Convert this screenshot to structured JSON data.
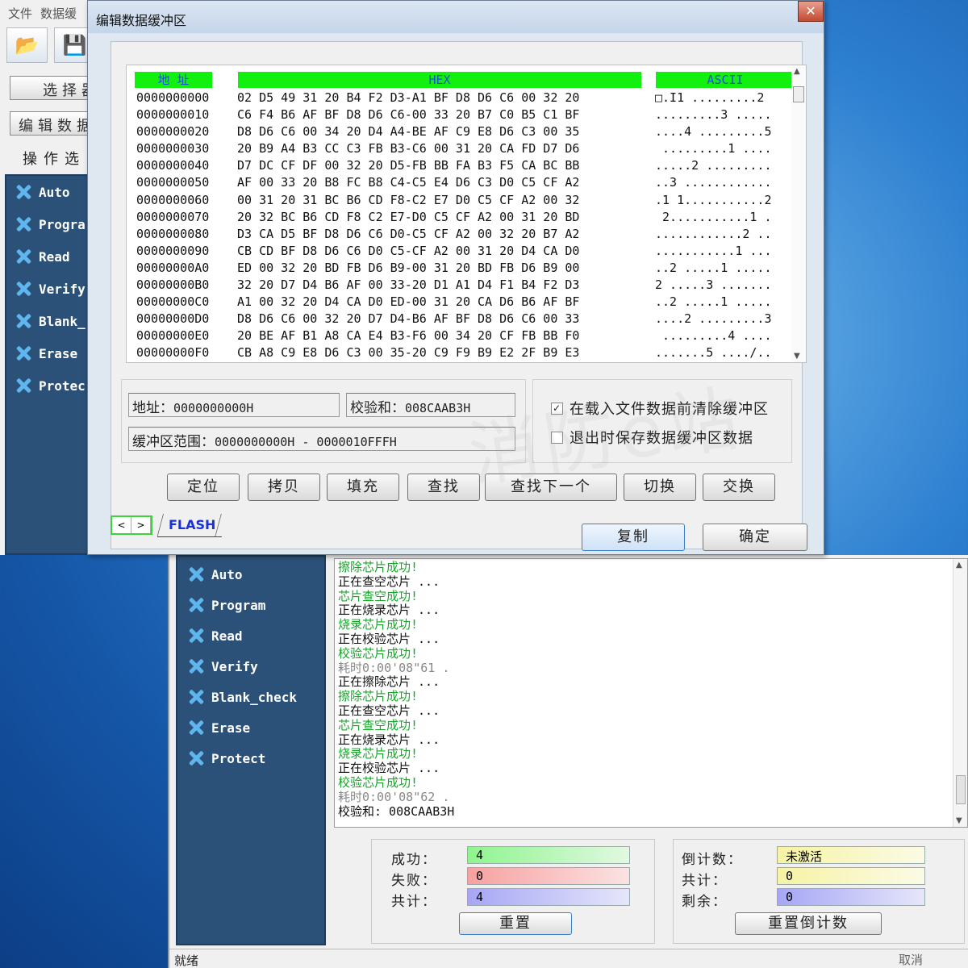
{
  "back_window": {
    "menu": [
      "文件",
      "数据缓"
    ],
    "select_button": "选择器",
    "edit_button": "编辑数据",
    "ops_label": "操作选",
    "nav": [
      "Auto",
      "Progra",
      "Read",
      "Verify",
      "Blank_",
      "Erase",
      "Protec"
    ]
  },
  "dialog": {
    "title": "编辑数据缓冲区",
    "close": "✕",
    "hex_headers": {
      "address": "地    址",
      "hex": "HEX",
      "ascii": "ASCII"
    },
    "rows": [
      {
        "addr": "0000000000",
        "bytes": "02 D5 49 31 20 B4 F2 D3-A1 BF D8 D6 C6 00 32 20",
        "ascii": "□.I1 .........2"
      },
      {
        "addr": "0000000010",
        "bytes": "C6 F4 B6 AF BF D8 D6 C6-00 33 20 B7 C0 B5 C1 BF",
        "ascii": ".........3 ....."
      },
      {
        "addr": "0000000020",
        "bytes": "D8 D6 C6 00 34 20 D4 A4-BE AF C9 E8 D6 C3 00 35",
        "ascii": "....4 .........5"
      },
      {
        "addr": "0000000030",
        "bytes": "20 B9 A4 B3 CC C3 FB B3-C6 00 31 20 CA FD D7 D6",
        "ascii": " .........1 ...."
      },
      {
        "addr": "0000000040",
        "bytes": "D7 DC CF DF 00 32 20 D5-FB BB FA B3 F5 CA BC BB",
        "ascii": ".....2 ........."
      },
      {
        "addr": "0000000050",
        "bytes": "AF 00 33 20 B8 FC B8 C4-C5 E4 D6 C3 D0 C5 CF A2",
        "ascii": "..3 ............"
      },
      {
        "addr": "0000000060",
        "bytes": "00 31 20 31 BC B6 CD F8-C2 E7 D0 C5 CF A2 00 32",
        "ascii": ".1 1...........2"
      },
      {
        "addr": "0000000070",
        "bytes": "20 32 BC B6 CD F8 C2 E7-D0 C5 CF A2 00 31 20 BD",
        "ascii": " 2...........1 ."
      },
      {
        "addr": "0000000080",
        "bytes": "D3 CA D5 BF D8 D6 C6 D0-C5 CF A2 00 32 20 B7 A2",
        "ascii": "............2 .."
      },
      {
        "addr": "0000000090",
        "bytes": "CB CD BF D8 D6 C6 D0 C5-CF A2 00 31 20 D4 CA D0",
        "ascii": "...........1 ..."
      },
      {
        "addr": "00000000A0",
        "bytes": "ED 00 32 20 BD FB D6 B9-00 31 20 BD FB D6 B9 00",
        "ascii": "..2 .....1 ....."
      },
      {
        "addr": "00000000B0",
        "bytes": "32 20 D7 D4 B6 AF 00 33-20 D1 A1 D4 F1 B4 F2 D3",
        "ascii": "2 .....3 ......."
      },
      {
        "addr": "00000000C0",
        "bytes": "A1 00 32 20 D4 CA D0 ED-00 31 20 CA D6 B6 AF BF",
        "ascii": "..2 .....1 ....."
      },
      {
        "addr": "00000000D0",
        "bytes": "D8 D6 C6 00 32 20 D7 D4-B6 AF BF D8 D6 C6 00 33",
        "ascii": "....2 .........3"
      },
      {
        "addr": "00000000E0",
        "bytes": "20 BE AF B1 A8 CA E4 B3-F6 00 34 20 CF FB BB F0",
        "ascii": " .........4 ...."
      },
      {
        "addr": "00000000F0",
        "bytes": "CB A8 C9 E8 D6 C3 00 35-20 C9 F9 B9 E2 2F B9 E3",
        "ascii": ".......5 ..../.."
      }
    ],
    "address_label": "地址：",
    "address_value": "0000000000H",
    "checksum_label": "校验和：",
    "checksum_value": "008CAAB3H",
    "range_label": "缓冲区范围：",
    "range_value": "0000000000H - 0000010FFFH",
    "opt_clear": {
      "label": "在载入文件数据前清除缓冲区",
      "checked": true
    },
    "opt_save": {
      "label": "退出时保存数据缓冲区数据",
      "checked": false
    },
    "buttons": [
      "定位",
      "拷贝",
      "填充",
      "查找",
      "查找下一个",
      "切换",
      "交换"
    ],
    "tab_prev": "<",
    "tab_next": ">",
    "tab": "FLASH",
    "copy_button": "复制",
    "ok_button": "确定",
    "watermark": "消防e站"
  },
  "main_window": {
    "nav": [
      "Auto",
      "Program",
      "Read",
      "Verify",
      "Blank_check",
      "Erase",
      "Protect"
    ],
    "log": [
      {
        "text": "擦除芯片成功!",
        "style": "green"
      },
      {
        "text": "正在查空芯片 ...",
        "style": "black"
      },
      {
        "text": "芯片查空成功!",
        "style": "green"
      },
      {
        "text": "正在烧录芯片 ...",
        "style": "black"
      },
      {
        "text": "烧录芯片成功!",
        "style": "green"
      },
      {
        "text": "正在校验芯片 ...",
        "style": "black"
      },
      {
        "text": "校验芯片成功!",
        "style": "green"
      },
      {
        "text": "耗时0:00'08\"61 .",
        "style": "gray"
      },
      {
        "text": "正在擦除芯片 ...",
        "style": "black"
      },
      {
        "text": "擦除芯片成功!",
        "style": "green"
      },
      {
        "text": "正在查空芯片 ...",
        "style": "black"
      },
      {
        "text": "芯片查空成功!",
        "style": "green"
      },
      {
        "text": "正在烧录芯片 ...",
        "style": "black"
      },
      {
        "text": "烧录芯片成功!",
        "style": "green"
      },
      {
        "text": "正在校验芯片 ...",
        "style": "black"
      },
      {
        "text": "校验芯片成功!",
        "style": "green"
      },
      {
        "text": "耗时0:00'08\"62 .",
        "style": "gray"
      },
      {
        "text": "校验和: 008CAAB3H",
        "style": "black"
      }
    ],
    "stats": {
      "success_label": "成功：",
      "success_value": "4",
      "fail_label": "失败：",
      "fail_value": "0",
      "total_label": "共计：",
      "total_value": "4",
      "reset_button": "重置",
      "countdown_label": "倒计数：",
      "countdown_value": "未激活",
      "count_total_label": "共计：",
      "count_total_value": "0",
      "remain_label": "剩余：",
      "remain_value": "0",
      "reset_countdown_button": "重置倒计数"
    },
    "status": "就绪",
    "status_cancel": "取消",
    "colors": {
      "green_bar": "#8ef58e",
      "red_bar": "#f7a0a0",
      "blue_bar": "#a6a6f5",
      "yellow_bar": "#f6f3a4",
      "nav_bg": "#2b5178",
      "hex_header": "#11f00e"
    }
  }
}
